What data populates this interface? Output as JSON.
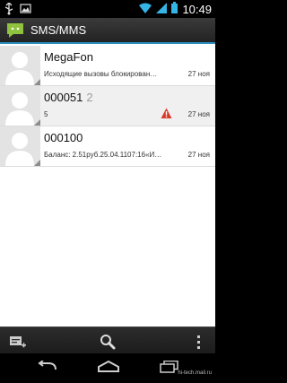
{
  "status_bar": {
    "time": "10:49",
    "left_icons": [
      "usb-icon",
      "image-notification-icon"
    ],
    "right_icons": [
      "wifi-icon",
      "signal-icon",
      "battery-icon"
    ]
  },
  "app_bar": {
    "title": "SMS/MMS",
    "icon": "messaging-app-icon"
  },
  "threads": [
    {
      "name": "MegaFon",
      "count": "",
      "snippet": "Исходящие вызовы блокирован…",
      "date": "27 ноя",
      "warning": false
    },
    {
      "name": "000051",
      "count": "2",
      "snippet": "5",
      "date": "27 ноя",
      "warning": true
    },
    {
      "name": "000100",
      "count": "",
      "snippet": "Баланс: 2.51руб.25.04.1107:16«И…",
      "date": "27 ноя",
      "warning": false
    }
  ],
  "toolbar": {
    "icons": [
      "compose-icon",
      "search-icon",
      "overflow-menu-icon"
    ]
  },
  "nav_bar": {
    "icons": [
      "back-icon",
      "home-icon",
      "recent-apps-icon"
    ],
    "watermark": "hi-tech.mail.ru"
  },
  "colors": {
    "accent": "#2a8fbd",
    "app_green": "#8fc23e",
    "warning_red": "#d83b2a"
  }
}
